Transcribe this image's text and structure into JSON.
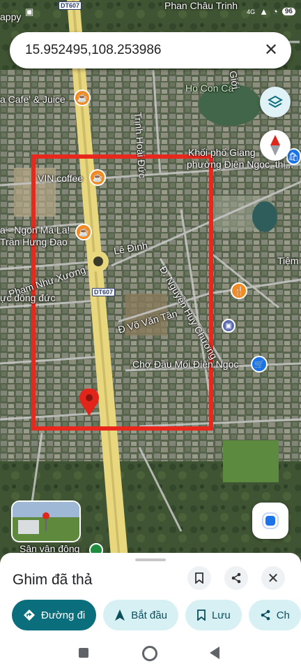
{
  "status": {
    "time_text": "",
    "network": "4G",
    "battery": "96"
  },
  "search": {
    "value": "15.952495,108.253986",
    "close_icon": "close-icon"
  },
  "map_labels": {
    "road_badge_top": "DT607",
    "road_badge_mid": "DT607",
    "top_right_street": "Phan Châu Trinh",
    "happy": "appy",
    "cafe_juice": "a Cafe' & Juice",
    "trinh_hoai_duc": "Trịnh Hoài Đức",
    "ho_con_ca": "Hồ Con Cá",
    "gioi": "Giới",
    "khoi_pho": "Khối phố Giang",
    "phuong": "phường Điện Ngọc, thị...",
    "vin_coffee": "VIN coffee",
    "ngon_ma_la": "a - Ngon Má La!",
    "tran_hung_dao": "Trần Hưng Đạo",
    "le_dinh": "Lê Đình",
    "pham_nhu_xuong": "Phạm Như Xương",
    "tiem": "Tiệm",
    "nguyen_huy_chuong": "Đ. Nguyễn Huy Chương",
    "ruc_dong_duc": "ực đông đức",
    "vo_van_tan": "Đ Võ Văn Tần",
    "cho_dau_moi": "Chợ Đầu Mối Điện Ngọc",
    "san_van_dong": "Sân vận động"
  },
  "selection_rect_color": "#e8281d",
  "pin_color": "#e1251b",
  "sheet": {
    "title": "Ghim đã thả",
    "actions": [
      {
        "label": "Đường đi",
        "icon": "directions-icon"
      },
      {
        "label": "Bắt đầu",
        "icon": "navigation-arrow-icon"
      },
      {
        "label": "Lưu",
        "icon": "bookmark-icon"
      },
      {
        "label": "Ch",
        "icon": "share-icon"
      }
    ]
  }
}
